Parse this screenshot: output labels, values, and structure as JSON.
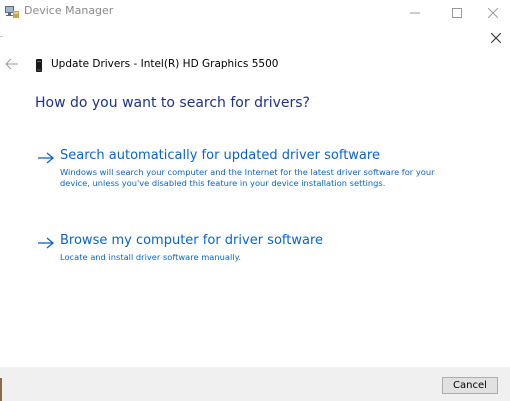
{
  "window": {
    "title": "Device Manager",
    "controls": {
      "minimize_icon": "minimize-icon",
      "maximize_icon": "maximize-icon",
      "close_icon": "close-icon"
    }
  },
  "dialog": {
    "title": "Update Drivers - Intel(R) HD Graphics 5500",
    "heading": "How do you want to search for drivers?",
    "options": [
      {
        "title": "Search automatically for updated driver software",
        "description": "Windows will search your computer and the Internet for the latest driver software for your device, unless you've disabled this feature in your device installation settings."
      },
      {
        "title": "Browse my computer for driver software",
        "description": "Locate and install driver software manually."
      }
    ],
    "cancel_label": "Cancel"
  },
  "colors": {
    "heading": "#1e3287",
    "link": "#0a64c8",
    "footer_bg": "#f0f0f0"
  }
}
